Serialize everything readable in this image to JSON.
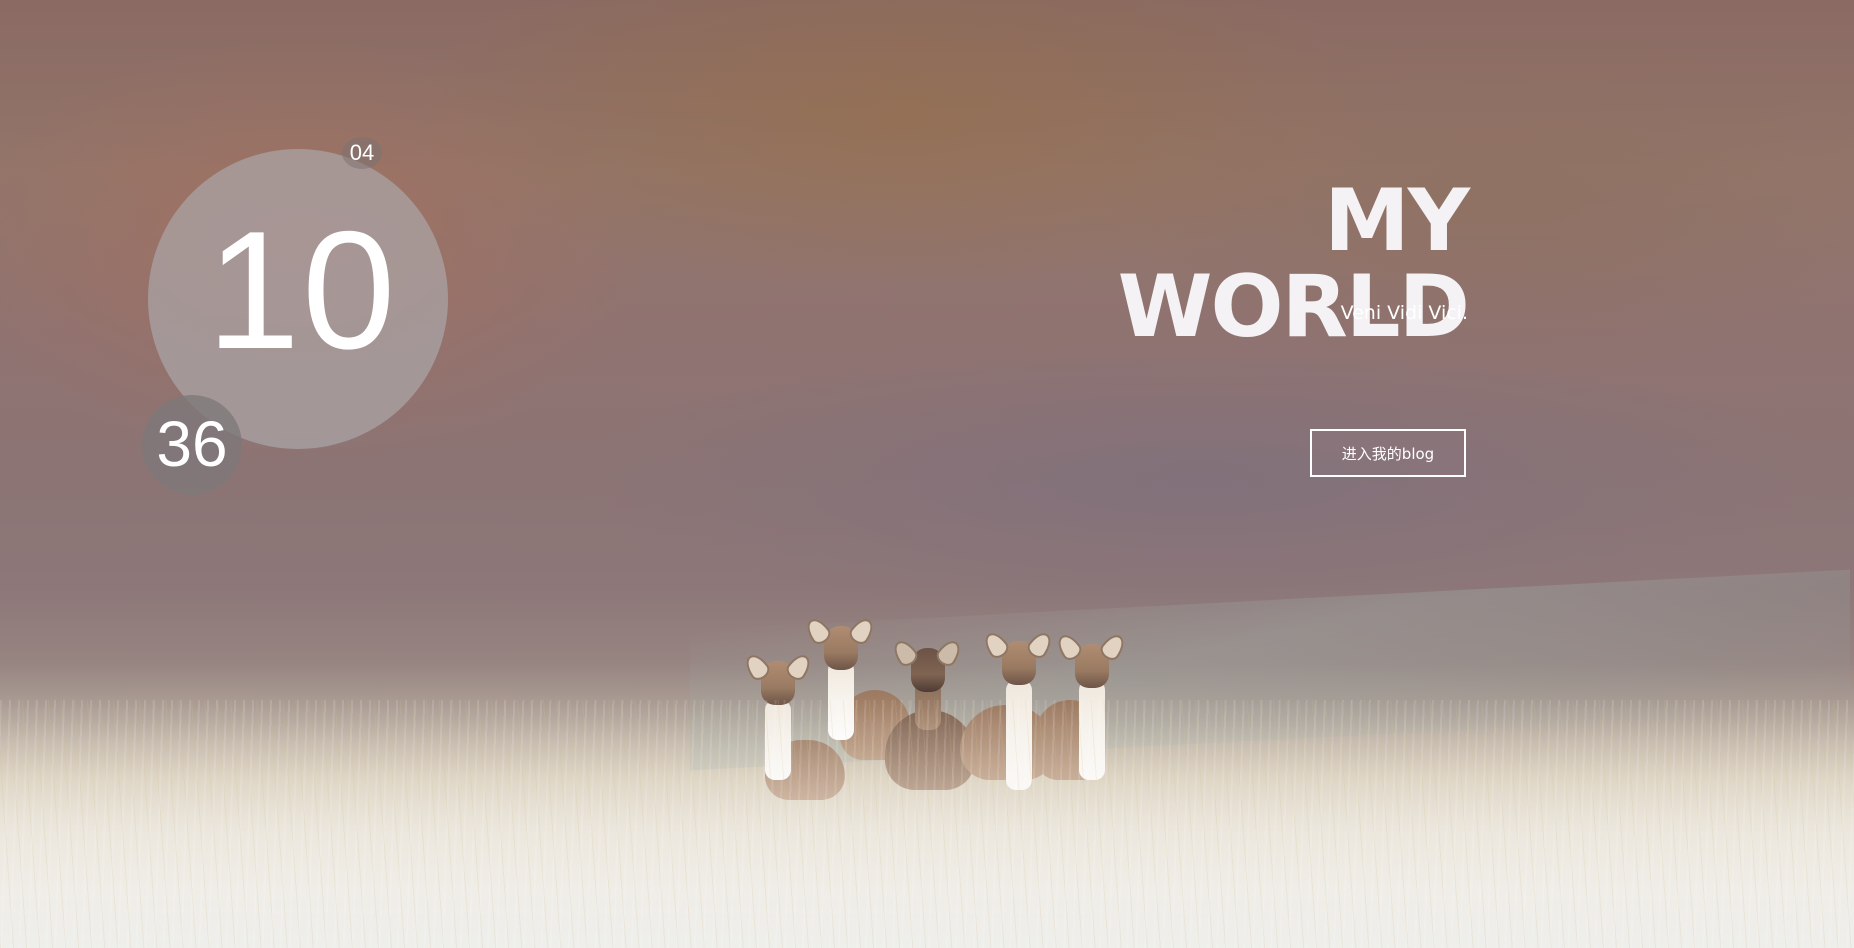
{
  "clock": {
    "hours": "10",
    "minutes": "36",
    "seconds": "04"
  },
  "hero": {
    "title": "MY WORLD",
    "subtitle": "Veni Vidi Vici.",
    "enter_button_label": "进入我的blog"
  },
  "background": {
    "scene": "deer-in-grass-photo",
    "deer_count": 5
  }
}
